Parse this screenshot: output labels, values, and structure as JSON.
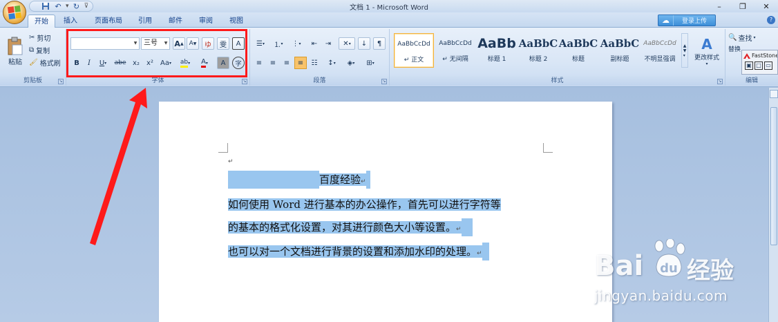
{
  "window": {
    "title": "文档 1 - Microsoft Word",
    "controls": [
      "–",
      "❐",
      "✕"
    ]
  },
  "quick_access": {
    "items": [
      "save-icon",
      "undo-icon",
      "redo-icon",
      "customize-icon"
    ]
  },
  "tabs": [
    "开始",
    "插入",
    "页面布局",
    "引用",
    "邮件",
    "审阅",
    "视图"
  ],
  "active_tab": "开始",
  "login_button": "登录上传",
  "clipboard": {
    "paste_label": "粘贴",
    "cut_label": "剪切",
    "copy_label": "复制",
    "format_painter_label": "格式刷",
    "group_label": "剪贴板"
  },
  "font": {
    "font_name_value": "",
    "font_size_value": "三号",
    "grow_label": "A",
    "shrink_label": "A",
    "clear_format_label": "ゆ",
    "phonetic_label": "雯",
    "char_border_label": "A",
    "bold_label": "B",
    "italic_label": "I",
    "underline_label": "U",
    "strike_label": "abe",
    "subscript_label": "x₂",
    "superscript_label": "x²",
    "case_label": "Aa",
    "highlight_label": "ab",
    "font_color_label": "A",
    "char_shading_label": "A",
    "enclose_label": "字",
    "group_label": "字体"
  },
  "paragraph": {
    "group_label": "段落"
  },
  "styles": {
    "items": [
      {
        "sample": "AaBbCcDd",
        "name": "↵ 正文"
      },
      {
        "sample": "AaBbCcDd",
        "name": "↵ 无间隔"
      },
      {
        "sample": "AaBb",
        "name": "标题 1"
      },
      {
        "sample": "AaBbC",
        "name": "标题 2"
      },
      {
        "sample": "AaBbC",
        "name": "标题"
      },
      {
        "sample": "AaBbC",
        "name": "副标题"
      },
      {
        "sample": "AaBbCcDd",
        "name": "不明显强调"
      }
    ],
    "change_styles_label": "更改样式",
    "group_label": "样式"
  },
  "editing": {
    "find_label": "查找",
    "replace_label": "替换",
    "group_label": "编辑"
  },
  "faststone": {
    "title": "FastStone"
  },
  "document": {
    "paragraph_mark": "↵",
    "lines": [
      "百度经验",
      "如何使用 Word 进行基本的办公操作，首先可以进行字符等",
      "的基本的格式化设置，对其进行颜色大小等设置。",
      "也可以对一个文档进行背景的设置和添加水印的处理。"
    ]
  },
  "watermark": {
    "brand": "Bai",
    "brand_cn": "经验",
    "url": "jingyan.baidu.com"
  },
  "colors": {
    "highlight": "#99c6ef",
    "annotation_red": "#ff1a1a",
    "ribbon_bg": "#d9e6f6"
  }
}
